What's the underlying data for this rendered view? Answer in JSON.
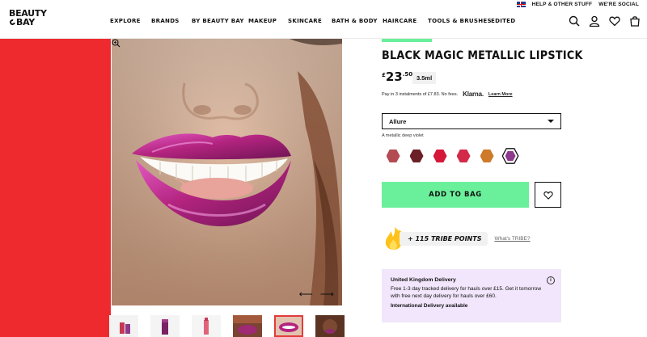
{
  "utility": {
    "help_label": "HELP & OTHER STUFF",
    "social_label": "WE'RE SOCIAL"
  },
  "logo": {
    "line1": "BEAUTY",
    "line2": "BAY"
  },
  "nav": [
    "EXPLORE",
    "BRANDS",
    "BY BEAUTY BAY",
    "MAKEUP",
    "SKINCARE",
    "BATH & BODY",
    "HAIRCARE",
    "TOOLS & BRUSHES",
    "EDITED"
  ],
  "header_icons": [
    "search-icon",
    "account-icon",
    "wishlist-heart-icon",
    "bag-icon"
  ],
  "product": {
    "title": "BLACK MAGIC METALLIC LIPSTICK",
    "price_currency": "£",
    "price_main": "23",
    "price_cents": ".50",
    "size": "3.5ml",
    "klarna_text": "Pay in 3 instalments of £7.83. No fees.",
    "klarna_brand": "Klarna.",
    "klarna_link": "Learn More",
    "shade_selected": "Allure",
    "shade_description": "A metallic deep violet",
    "swatches": [
      "#b34c52",
      "#6b1f27",
      "#d5183a",
      "#d42a4a",
      "#cd7a2a",
      "#8e3a8c"
    ],
    "active_swatch_index": 5,
    "add_to_bag_label": "ADD TO BAG",
    "tribe_points": "+ 115 TRIBE POINTS",
    "tribe_link": "What's TRIBE?"
  },
  "delivery": {
    "heading": "United Kingdom Delivery",
    "text": "Free 1-3 day tracked delivery for hauls over £15. Get it tomorrow with free next day delivery for hauls over £60.",
    "international": "International Delivery available"
  },
  "colors": {
    "accent_green": "#69f09a",
    "brand_red": "#ee2a2f",
    "delivery_bg": "#f1e6fb"
  }
}
